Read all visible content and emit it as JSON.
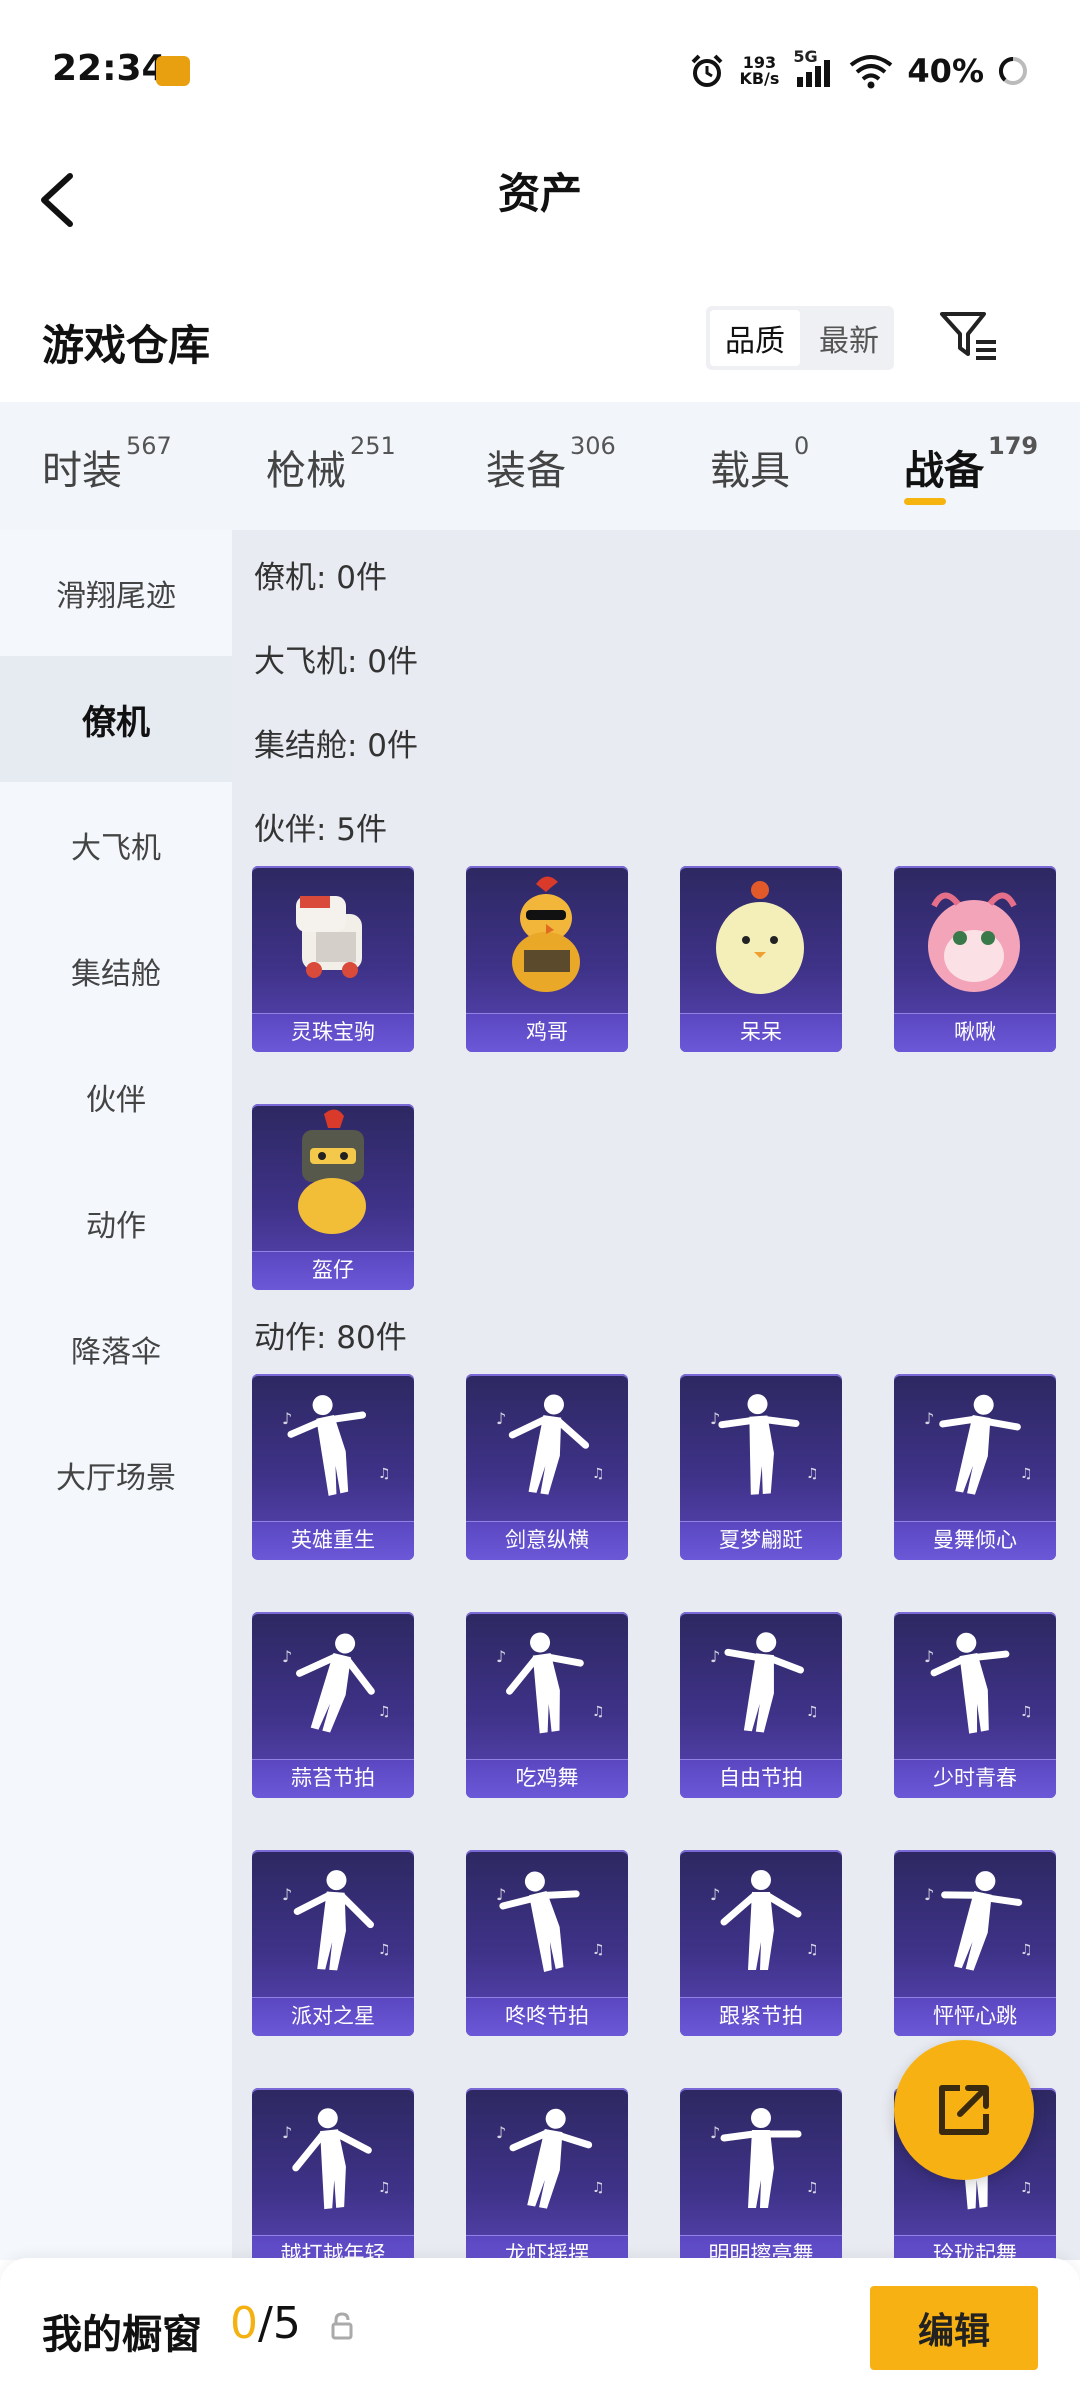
{
  "status_bar": {
    "time": "22:34",
    "net_speed_value": "193",
    "net_speed_unit": "KB/s",
    "network_label": "5G",
    "battery": "40%",
    "icons": [
      "app-icon",
      "alarm-icon",
      "signal-icon",
      "wifi-icon",
      "battery-icon"
    ]
  },
  "header": {
    "title": "资产"
  },
  "section": {
    "title": "游戏仓库",
    "sort_options": [
      "品质",
      "最新"
    ],
    "active_sort": "品质"
  },
  "categories": [
    {
      "label": "时装",
      "count": "567"
    },
    {
      "label": "枪械",
      "count": "251"
    },
    {
      "label": "装备",
      "count": "306"
    },
    {
      "label": "载具",
      "count": "0"
    },
    {
      "label": "战备",
      "count": "179",
      "active": true
    }
  ],
  "sidebar": {
    "items": [
      "滑翔尾迹",
      "僚机",
      "大飞机",
      "集结舱",
      "伙伴",
      "动作",
      "降落伞",
      "大厅场景"
    ],
    "active": "僚机"
  },
  "content": {
    "groups": [
      {
        "label": "僚机: 0件"
      },
      {
        "label": "大飞机: 0件"
      },
      {
        "label": "集结舱: 0件"
      },
      {
        "label": "伙伴: 5件"
      },
      {
        "label": "动作: 80件"
      }
    ],
    "partners": [
      "灵珠宝驹",
      "鸡哥",
      "呆呆",
      "啾啾",
      "盔仔"
    ],
    "actions": [
      "英雄重生",
      "剑意纵横",
      "夏梦翩跹",
      "曼舞倾心",
      "蒜苔节拍",
      "吃鸡舞",
      "自由节拍",
      "少时青春",
      "派对之星",
      "咚咚节拍",
      "跟紧节拍",
      "怦怦心跳",
      "越打越年轻",
      "龙虾摇摆",
      "明明擦亮舞",
      "玲珑起舞"
    ]
  },
  "bottom_bar": {
    "title": "我的橱窗",
    "count_current": "0",
    "count_total": "/5",
    "edit_label": "编辑"
  },
  "colors": {
    "accent": "#f7b112",
    "card_bg": "#3e3288",
    "content_bg": "#e8ebf1",
    "sidebar_bg": "#f4f8fc"
  }
}
